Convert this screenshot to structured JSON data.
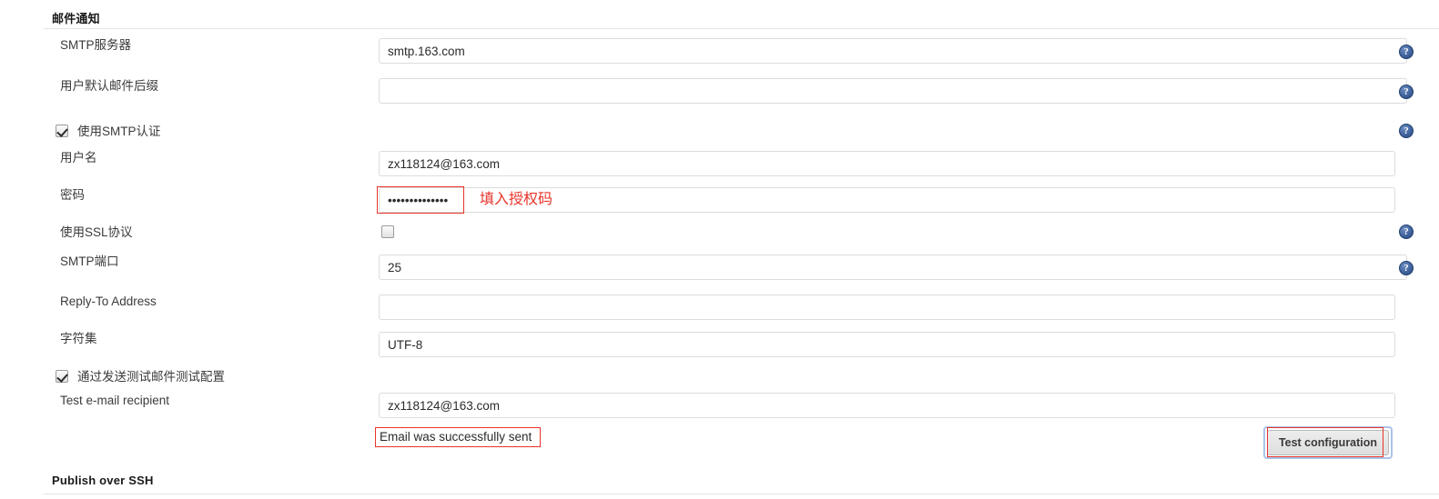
{
  "sections": {
    "email": {
      "title": "邮件通知"
    },
    "ssh": {
      "title": "Publish over SSH"
    }
  },
  "form": {
    "rows": [
      {
        "label": "SMTP服务器",
        "value": "smtp.163.com",
        "placeholder": ""
      },
      {
        "label": "用户默认邮件后缀",
        "value": "",
        "placeholder": ""
      },
      {
        "label": "用户名",
        "value": "zx118124@163.com",
        "placeholder": ""
      },
      {
        "label": "密码",
        "value": "••••••••••••••",
        "placeholder": ""
      },
      {
        "label": "SMTP端口",
        "value": "25",
        "placeholder": ""
      },
      {
        "label": "Reply-To Address",
        "value": "",
        "placeholder": ""
      },
      {
        "label": "字符集",
        "value": "UTF-8",
        "placeholder": ""
      },
      {
        "label": "Test e-mail recipient",
        "value": "zx118124@163.com",
        "placeholder": ""
      }
    ],
    "checkboxes": [
      {
        "label": "使用SMTP认证",
        "checked": true
      },
      {
        "label": "使用SSL协议",
        "checked": false
      },
      {
        "label": "通过发送测试邮件测试配置",
        "checked": true
      }
    ]
  },
  "status": {
    "email_sent": "Email was successfully sent"
  },
  "buttons": {
    "test_configuration": "Test configuration"
  },
  "icons": {
    "help": "?",
    "help_name": "help-icon"
  },
  "annotations": {
    "password_note": "填入授权码",
    "accent_red": "#e8342a"
  }
}
